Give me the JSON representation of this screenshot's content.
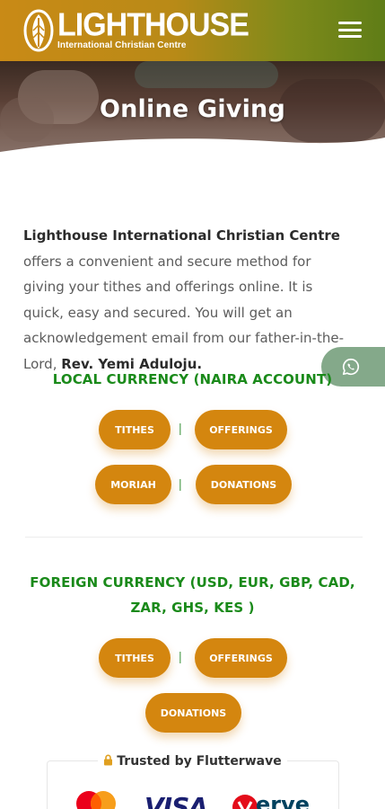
{
  "header": {
    "logo_title": "LIGHTHOUSE",
    "logo_subtitle": "International Christian Centre",
    "menu_icon": "hamburger-menu-icon"
  },
  "hero": {
    "title": "Online Giving"
  },
  "intro": {
    "org_name": "Lighthouse International Christian Centre",
    "text_before_pastor": " offers a convenient and secure method for giving your tithes and offerings online. It is quick, easy and secured. You will get an acknowledgement email from our father-in-the-Lord, ",
    "pastor_name": "Rev. Yemi Aduloju."
  },
  "local": {
    "title": "LOCAL CURRENCY (NAIRA ACCOUNT)",
    "buttons": [
      "TITHES",
      "OFFERINGS",
      "MORIAH",
      "DONATIONS"
    ],
    "separator": "|"
  },
  "foreign": {
    "title": "FOREIGN CURRENCY (USD, EUR, GBP, CAD, ZAR, GHS, KES )",
    "buttons": [
      "TITHES",
      "OFFERINGS",
      "DONATIONS"
    ],
    "separator": "|"
  },
  "trust": {
    "label": "Trusted by Flutterwave",
    "logos": [
      "mastercard-icon",
      "VISA",
      "Verve"
    ]
  },
  "colors": {
    "accent": "#d4860f",
    "green_title": "#1a8a1a",
    "header_start": "#c98a16",
    "header_end": "#5f7d17",
    "whatsapp": "#84a98a"
  }
}
